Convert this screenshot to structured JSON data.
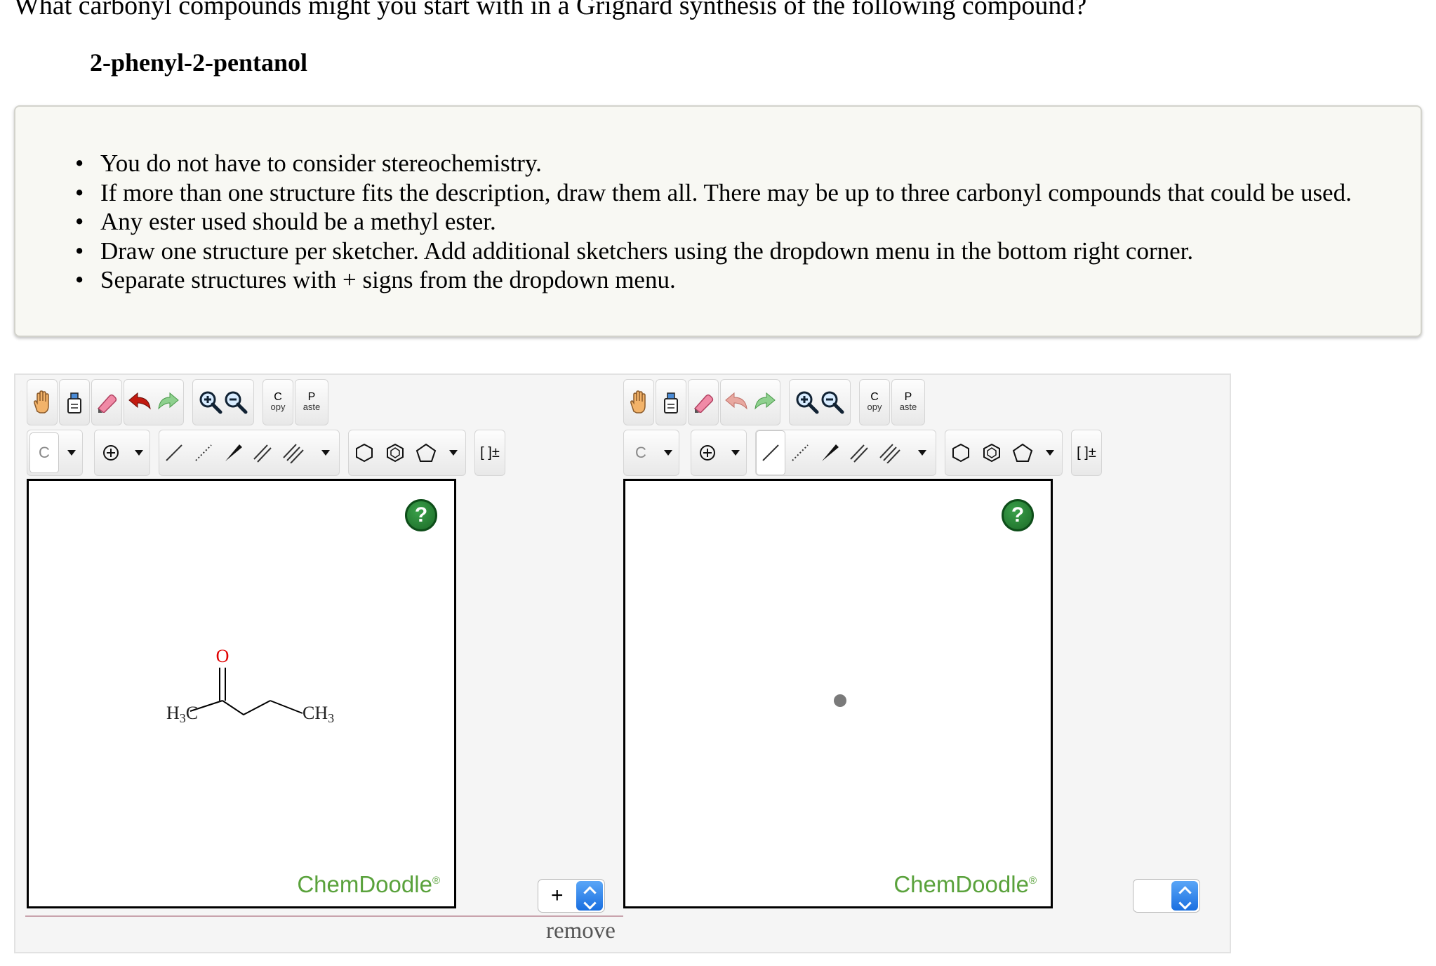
{
  "question": "What carbonyl compounds might you start with in a Grignard synthesis of the following compound?",
  "target_compound": "2-phenyl-2-pentanol",
  "instructions": [
    "You do not have to consider stereochemistry.",
    "If more than one structure fits the description, draw them all. There may be up to three carbonyl compounds that could be used.",
    "Any ester used should be a methyl ester.",
    "Draw one structure per sketcher. Add additional sketchers using the dropdown menu in the bottom right corner.",
    "Separate structures with + signs from the dropdown menu."
  ],
  "toolbar": {
    "copy_top": "C",
    "copy_bottom": "opy",
    "paste_top": "P",
    "paste_bottom": "aste",
    "element_value": "C",
    "bracket_label": "[ ]±"
  },
  "sketcher1": {
    "logo": "ChemDoodle",
    "logo_mark": "®",
    "help": "?",
    "molecule": {
      "atom_o": "O",
      "left_group_main": "H",
      "left_group_sub": "3",
      "left_group_tail": "C",
      "right_group_main": "CH",
      "right_group_sub": "3"
    }
  },
  "sketcher2": {
    "logo": "ChemDoodle",
    "logo_mark": "®",
    "help": "?"
  },
  "separator_select": {
    "value": "+"
  },
  "last_select": {
    "value": ""
  },
  "remove_link": "remove",
  "colors": {
    "logo_green": "#5aa23c",
    "help_green": "#1b6a27",
    "select_blue": "#1a6fe0",
    "oxygen_red": "#e00000"
  }
}
